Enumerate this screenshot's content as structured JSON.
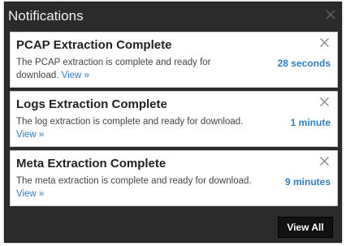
{
  "panel": {
    "title": "Notifications"
  },
  "notifications": [
    {
      "title": "PCAP Extraction Complete",
      "description": "The PCAP extraction is complete and ready for download.",
      "link_label": "View »",
      "time": "28 seconds"
    },
    {
      "title": "Logs Extraction Complete",
      "description": "The log extraction is complete and ready for download.",
      "link_label": "View »",
      "time": "1 minute"
    },
    {
      "title": "Meta Extraction Complete",
      "description": "The meta extraction is complete and ready for download.",
      "link_label": "View »",
      "time": "9 minutes"
    }
  ],
  "footer": {
    "view_all_label": "View All"
  },
  "icons": {
    "panel_close": "close-icon",
    "dismiss": "close-icon"
  },
  "colors": {
    "panel_background": "#2b2b2b",
    "accent": "#2f7ebd",
    "button_background": "#111111"
  }
}
